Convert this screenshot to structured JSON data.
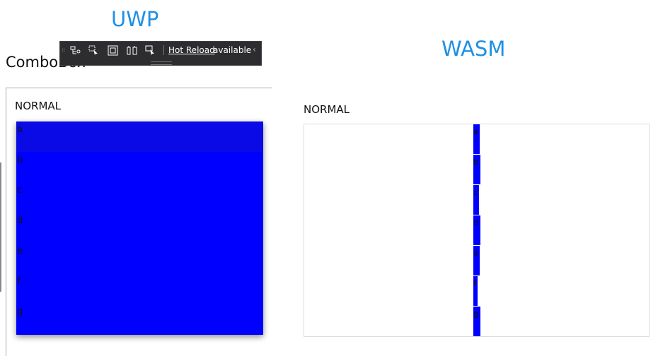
{
  "headings": {
    "uwp": "UWP",
    "wasm": "WASM"
  },
  "page": {
    "title": "ComboBox"
  },
  "dev_toolbar": {
    "hot_reload_link": "Hot Reload",
    "hot_reload_status": "available",
    "icons": [
      "live-visual-tree-icon",
      "select-element-icon",
      "display-layout-adorners-icon",
      "track-focus-icon",
      "preview-selection-icon",
      "collapse-icon"
    ]
  },
  "uwp": {
    "normal_label": "NORMAL",
    "items": [
      "a",
      "b",
      "c",
      "d",
      "e",
      "f",
      "g"
    ],
    "selected_index": 0
  },
  "wasm": {
    "normal_label": "NORMAL",
    "items": [
      "a",
      "b",
      "c",
      "d",
      "e",
      "f",
      "g"
    ]
  },
  "colors": {
    "accent": "#1e90e6",
    "dropdown_background": "#0000ff",
    "toolbar_background": "#2d2d30"
  }
}
